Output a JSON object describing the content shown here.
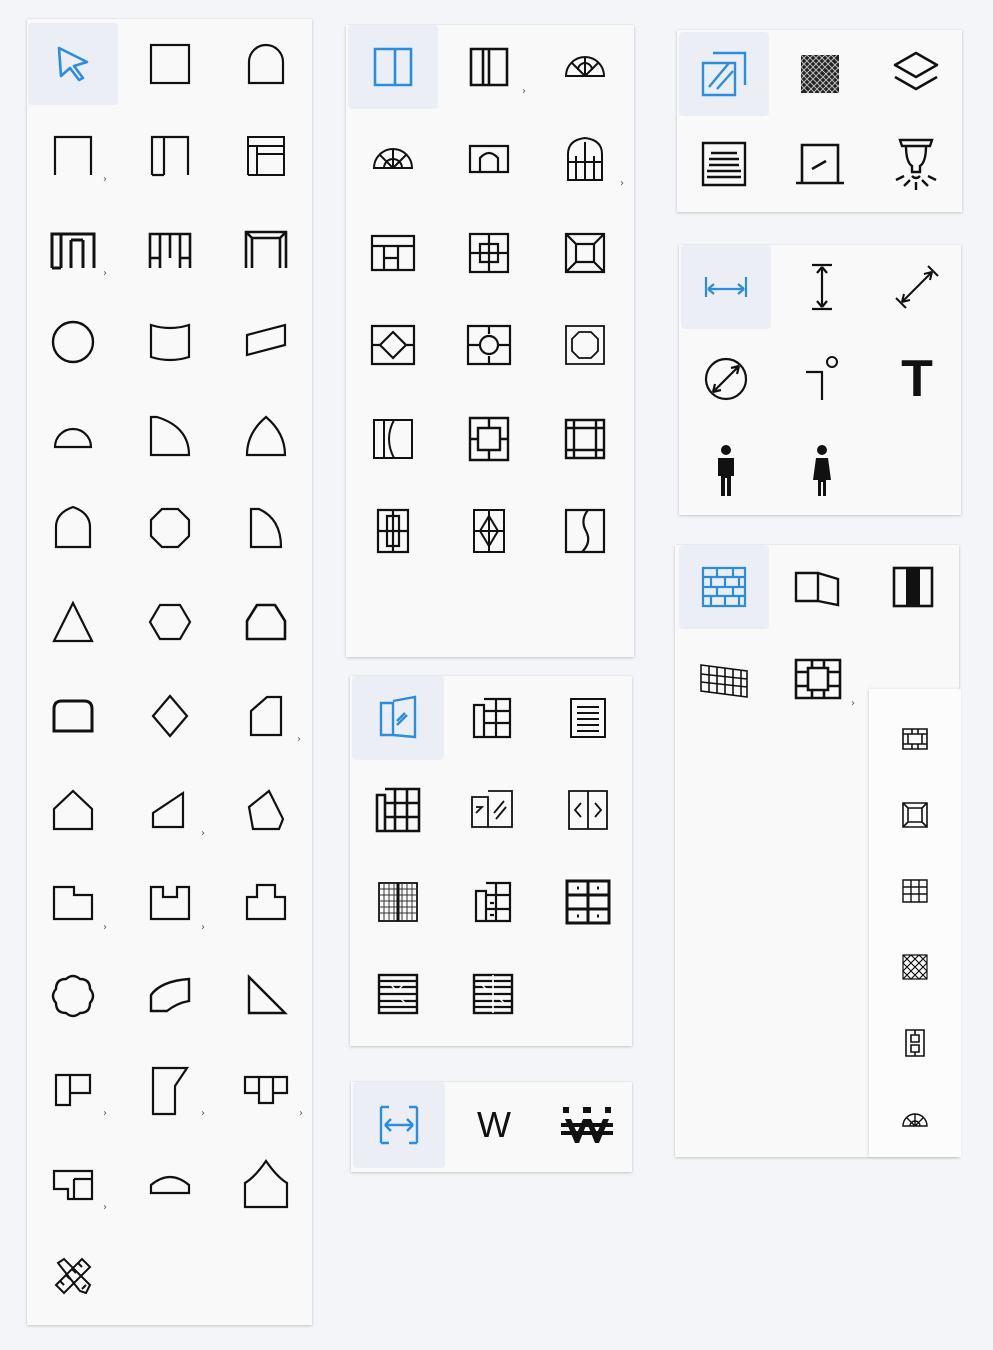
{
  "palettes": {
    "shapes": {
      "tools": [
        "select-tool",
        "rectangle-room",
        "arch-room",
        "bay-room",
        "double-bay-room",
        "bay-with-window-room",
        "triple-bay-room",
        "alternate-bay-room",
        "framed-bay-room",
        "circle-room",
        "curved-front-room",
        "parallelogram-room",
        "half-circle-room",
        "quarter-circle-room",
        "pointed-arch-room",
        "gothic-arch-room",
        "octagon-room",
        "d-shaped-room",
        "triangle-room",
        "hexagon-room",
        "trapezoid-room",
        "rounded-trapezoid-room",
        "diamond-room",
        "angled-room",
        "pentagon-room",
        "wedge-room",
        "irregular-pentagon-room",
        "l-shaped-room",
        "u-shaped-room",
        "notched-room",
        "quatrefoil-room",
        "curved-parallelogram-room",
        "right-triangle-room",
        "t-shaped-room",
        "folded-corner-room",
        "cross-shaped-room",
        "stepped-room",
        "low-arch-room",
        "onion-dome-room",
        "custom-draw-tool"
      ]
    },
    "windows": {
      "tools": [
        "single-window",
        "double-window",
        "fan-window",
        "half-round-window",
        "arched-window",
        "gothic-window",
        "grid-window",
        "cross-frame-window",
        "diagonal-frame-window",
        "diamond-frame-window",
        "circle-frame-window",
        "octagon-frame-window",
        "casement-window",
        "square-frame-window",
        "double-square-frame-window",
        "vertical-bar-window",
        "vertical-diamond-window",
        "wave-window"
      ]
    },
    "doors": {
      "tools": [
        "panel-door",
        "paneled-door",
        "louvered-door",
        "grid-door",
        "sliding-door",
        "french-door",
        "mesh-door",
        "cabinet-door",
        "quad-door",
        "lattice-door",
        "double-lattice-door"
      ]
    },
    "width": {
      "tools": [
        "width-measure",
        "wall-text",
        "wall-pattern"
      ],
      "w_label": "W",
      "wide_label": "₩"
    },
    "materials": {
      "tools": [
        "glass-material",
        "mesh-material",
        "layers",
        "stairs",
        "slope",
        "light-fixture"
      ]
    },
    "measure": {
      "tools": [
        "horizontal-dimension",
        "vertical-dimension",
        "diagonal-dimension",
        "diameter-dimension",
        "leader-note",
        "text-tool",
        "male-figure",
        "female-figure"
      ],
      "t_label": "T"
    },
    "walls": {
      "tools": [
        "brick-wall",
        "folding-wall",
        "column-wall",
        "perspective-grid-wall",
        "cross-panel-wall"
      ]
    },
    "wall_flyout": {
      "tools": [
        "notched-frame",
        "square-frame",
        "grid-frame",
        "crosshatch-frame",
        "double-frame",
        "fan-frame"
      ]
    }
  },
  "colors": {
    "active": "#2b8de0",
    "ink": "#1a1a1a",
    "active_bg": "#ebeff5"
  },
  "submenu_glyph": "›"
}
